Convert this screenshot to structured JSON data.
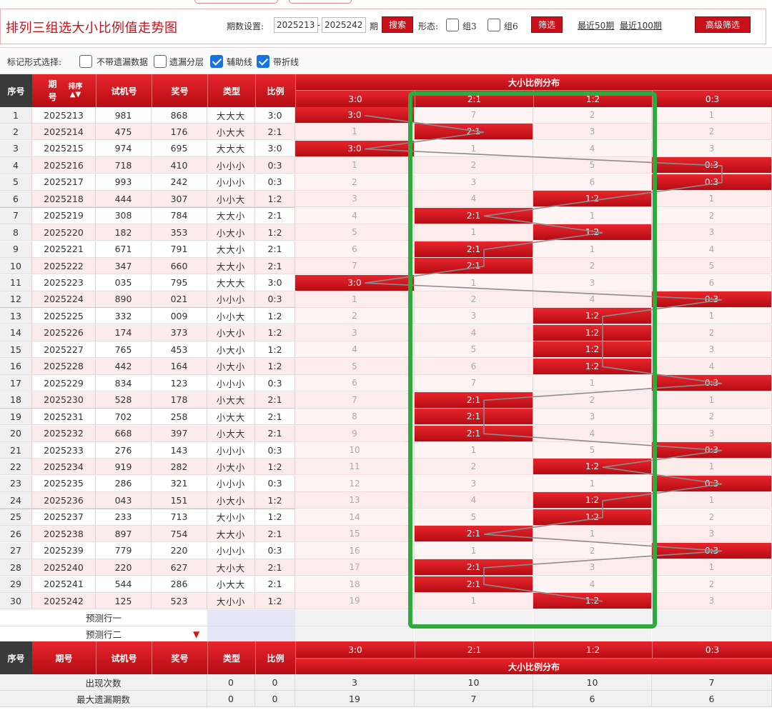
{
  "header": {
    "title": "排列三组选大小比例值走势图",
    "period_label": "期数设置:",
    "period_start": "2025213",
    "period_dash": "-",
    "period_end": "2025242",
    "period_unit": "期",
    "search_label": "搜索",
    "shape_label": "形态:",
    "group3_label": "组3",
    "group6_label": "组6",
    "filter_label": "筛选",
    "recent50_label": "最近50期",
    "recent100_label": "最近100期",
    "advanced_label": "高级筛选"
  },
  "marks": {
    "label": "标记形式选择:",
    "options": [
      {
        "label": "不带遗漏数据",
        "checked": false
      },
      {
        "label": "遗漏分层",
        "checked": false
      },
      {
        "label": "辅助线",
        "checked": true
      },
      {
        "label": "带折线",
        "checked": true
      }
    ]
  },
  "table": {
    "headers": {
      "idx": "序号",
      "period": "期号",
      "sort": "排序",
      "test": "试机号",
      "prize": "奖号",
      "type": "类型",
      "ratio": "比例",
      "dist": "大小比例分布"
    },
    "dist_cols": [
      "3:0",
      "2:1",
      "1:2",
      "0:3"
    ],
    "rows": [
      {
        "idx": "1",
        "period": "2025213",
        "test": "981",
        "prize": "868",
        "type": "大大大",
        "ratio": "3:0",
        "cells": [
          "3:0",
          "7",
          "2",
          "1"
        ],
        "hit": 0
      },
      {
        "idx": "2",
        "period": "2025214",
        "test": "475",
        "prize": "176",
        "type": "小大大",
        "ratio": "2:1",
        "cells": [
          "1",
          "2:1",
          "3",
          "2"
        ],
        "hit": 1
      },
      {
        "idx": "3",
        "period": "2025215",
        "test": "974",
        "prize": "695",
        "type": "大大大",
        "ratio": "3:0",
        "cells": [
          "3:0",
          "1",
          "4",
          "3"
        ],
        "hit": 0
      },
      {
        "idx": "4",
        "period": "2025216",
        "test": "718",
        "prize": "410",
        "type": "小小小",
        "ratio": "0:3",
        "cells": [
          "1",
          "2",
          "5",
          "0:3"
        ],
        "hit": 3
      },
      {
        "idx": "5",
        "period": "2025217",
        "test": "993",
        "prize": "242",
        "type": "小小小",
        "ratio": "0:3",
        "cells": [
          "2",
          "3",
          "6",
          "0:3"
        ],
        "hit": 3
      },
      {
        "idx": "6",
        "period": "2025218",
        "test": "444",
        "prize": "307",
        "type": "小小大",
        "ratio": "1:2",
        "cells": [
          "3",
          "4",
          "1:2",
          "1"
        ],
        "hit": 2
      },
      {
        "idx": "7",
        "period": "2025219",
        "test": "308",
        "prize": "784",
        "type": "大大小",
        "ratio": "2:1",
        "cells": [
          "4",
          "2:1",
          "1",
          "2"
        ],
        "hit": 1
      },
      {
        "idx": "8",
        "period": "2025220",
        "test": "182",
        "prize": "353",
        "type": "小大小",
        "ratio": "1:2",
        "cells": [
          "5",
          "1",
          "1:2",
          "3"
        ],
        "hit": 2
      },
      {
        "idx": "9",
        "period": "2025221",
        "test": "671",
        "prize": "791",
        "type": "大大小",
        "ratio": "2:1",
        "cells": [
          "6",
          "2:1",
          "1",
          "4"
        ],
        "hit": 1
      },
      {
        "idx": "10",
        "period": "2025222",
        "test": "347",
        "prize": "660",
        "type": "大大小",
        "ratio": "2:1",
        "cells": [
          "7",
          "2:1",
          "2",
          "5"
        ],
        "hit": 1
      },
      {
        "idx": "11",
        "period": "2025223",
        "test": "035",
        "prize": "795",
        "type": "大大大",
        "ratio": "3:0",
        "cells": [
          "3:0",
          "1",
          "3",
          "6"
        ],
        "hit": 0
      },
      {
        "idx": "12",
        "period": "2025224",
        "test": "890",
        "prize": "021",
        "type": "小小小",
        "ratio": "0:3",
        "cells": [
          "1",
          "2",
          "4",
          "0:3"
        ],
        "hit": 3
      },
      {
        "idx": "13",
        "period": "2025225",
        "test": "332",
        "prize": "009",
        "type": "小小大",
        "ratio": "1:2",
        "cells": [
          "2",
          "3",
          "1:2",
          "1"
        ],
        "hit": 2
      },
      {
        "idx": "14",
        "period": "2025226",
        "test": "174",
        "prize": "373",
        "type": "小大小",
        "ratio": "1:2",
        "cells": [
          "3",
          "4",
          "1:2",
          "2"
        ],
        "hit": 2
      },
      {
        "idx": "15",
        "period": "2025227",
        "test": "765",
        "prize": "453",
        "type": "小大小",
        "ratio": "1:2",
        "cells": [
          "4",
          "5",
          "1:2",
          "3"
        ],
        "hit": 2
      },
      {
        "idx": "16",
        "period": "2025228",
        "test": "442",
        "prize": "164",
        "type": "小大小",
        "ratio": "1:2",
        "cells": [
          "5",
          "6",
          "1:2",
          "4"
        ],
        "hit": 2
      },
      {
        "idx": "17",
        "period": "2025229",
        "test": "834",
        "prize": "123",
        "type": "小小小",
        "ratio": "0:3",
        "cells": [
          "6",
          "7",
          "1",
          "0:3"
        ],
        "hit": 3
      },
      {
        "idx": "18",
        "period": "2025230",
        "test": "528",
        "prize": "178",
        "type": "小大大",
        "ratio": "2:1",
        "cells": [
          "7",
          "2:1",
          "2",
          "1"
        ],
        "hit": 1
      },
      {
        "idx": "19",
        "period": "2025231",
        "test": "702",
        "prize": "258",
        "type": "小大大",
        "ratio": "2:1",
        "cells": [
          "8",
          "2:1",
          "3",
          "2"
        ],
        "hit": 1
      },
      {
        "idx": "20",
        "period": "2025232",
        "test": "668",
        "prize": "397",
        "type": "小大大",
        "ratio": "2:1",
        "cells": [
          "9",
          "2:1",
          "4",
          "3"
        ],
        "hit": 1
      },
      {
        "idx": "21",
        "period": "2025233",
        "test": "276",
        "prize": "143",
        "type": "小小小",
        "ratio": "0:3",
        "cells": [
          "10",
          "1",
          "5",
          "0:3"
        ],
        "hit": 3
      },
      {
        "idx": "22",
        "period": "2025234",
        "test": "919",
        "prize": "282",
        "type": "小大小",
        "ratio": "1:2",
        "cells": [
          "11",
          "2",
          "1:2",
          "1"
        ],
        "hit": 2
      },
      {
        "idx": "23",
        "period": "2025235",
        "test": "286",
        "prize": "321",
        "type": "小小小",
        "ratio": "0:3",
        "cells": [
          "12",
          "3",
          "1",
          "0:3"
        ],
        "hit": 3
      },
      {
        "idx": "24",
        "period": "2025236",
        "test": "043",
        "prize": "151",
        "type": "小大小",
        "ratio": "1:2",
        "cells": [
          "13",
          "4",
          "1:2",
          "1"
        ],
        "hit": 2
      },
      {
        "idx": "25",
        "period": "2025237",
        "test": "233",
        "prize": "713",
        "type": "大小小",
        "ratio": "1:2",
        "cells": [
          "14",
          "5",
          "1:2",
          "2"
        ],
        "hit": 2
      },
      {
        "idx": "26",
        "period": "2025238",
        "test": "897",
        "prize": "754",
        "type": "大大小",
        "ratio": "2:1",
        "cells": [
          "15",
          "2:1",
          "1",
          "3"
        ],
        "hit": 1
      },
      {
        "idx": "27",
        "period": "2025239",
        "test": "779",
        "prize": "220",
        "type": "小小小",
        "ratio": "0:3",
        "cells": [
          "16",
          "1",
          "2",
          "0:3"
        ],
        "hit": 3
      },
      {
        "idx": "28",
        "period": "2025240",
        "test": "220",
        "prize": "627",
        "type": "大小大",
        "ratio": "2:1",
        "cells": [
          "17",
          "2:1",
          "3",
          "1"
        ],
        "hit": 1
      },
      {
        "idx": "29",
        "period": "2025241",
        "test": "544",
        "prize": "286",
        "type": "小大大",
        "ratio": "2:1",
        "cells": [
          "18",
          "2:1",
          "4",
          "2"
        ],
        "hit": 1
      },
      {
        "idx": "30",
        "period": "2025242",
        "test": "125",
        "prize": "523",
        "type": "大小小",
        "ratio": "1:2",
        "cells": [
          "19",
          "1",
          "1:2",
          "3"
        ],
        "hit": 2
      }
    ],
    "predict": [
      "预测行一",
      "预测行二"
    ],
    "stats": [
      {
        "label": "出现次数",
        "type": "0",
        "ratio": "0",
        "values": [
          "3",
          "10",
          "10",
          "7"
        ]
      },
      {
        "label": "最大遗漏期数",
        "type": "0",
        "ratio": "0",
        "values": [
          "19",
          "7",
          "6",
          "6"
        ]
      }
    ]
  },
  "colors": {
    "brand_red": "#c8101a",
    "highlight_box": "#2eaa3f",
    "trend_line": "#8c8c8c"
  }
}
